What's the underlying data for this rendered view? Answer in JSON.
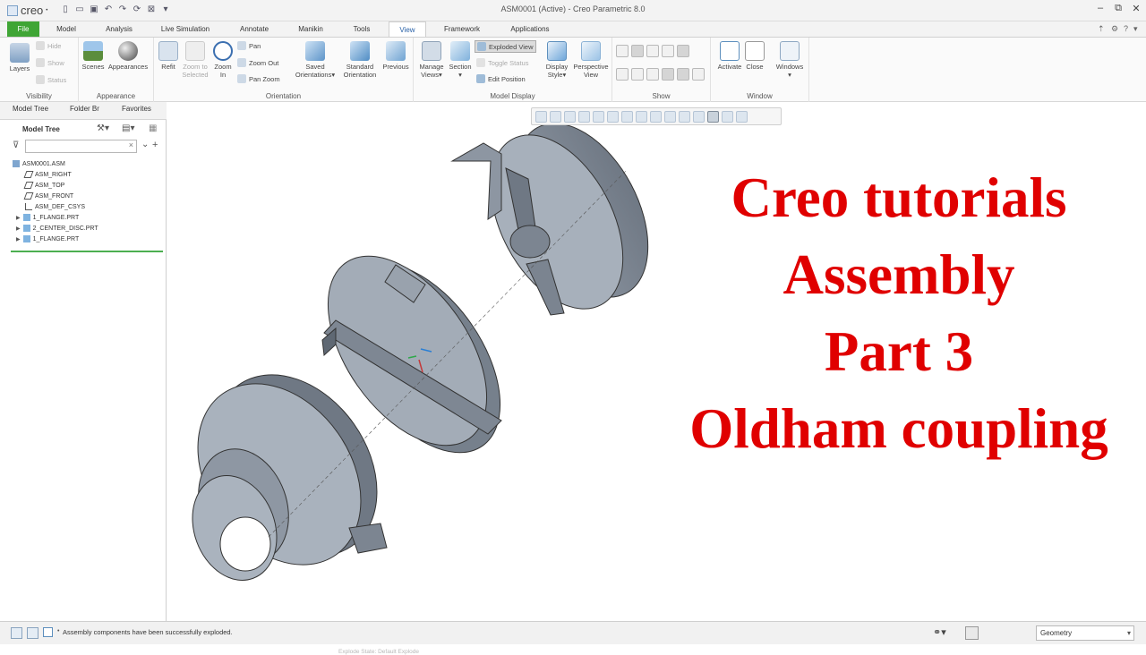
{
  "app": {
    "logo_text": "creo",
    "window_title": "ASM0001 (Active) - Creo Parametric 8.0"
  },
  "tabs": [
    {
      "label": "File"
    },
    {
      "label": "Model"
    },
    {
      "label": "Analysis"
    },
    {
      "label": "Live Simulation"
    },
    {
      "label": "Annotate"
    },
    {
      "label": "Manikin"
    },
    {
      "label": "Tools"
    },
    {
      "label": "View"
    },
    {
      "label": "Framework"
    },
    {
      "label": "Applications"
    }
  ],
  "ribbon": {
    "visibility": {
      "label": "Visibility",
      "layers": "Layers",
      "hide": "Hide",
      "show": "Show",
      "status": "Status"
    },
    "appearance": {
      "label": "Appearance",
      "scenes": "Scenes",
      "appearances": "Appearances"
    },
    "orientation": {
      "label": "Orientation",
      "refit": "Refit",
      "zoom_selected_1": "Zoom to",
      "zoom_selected_2": "Selected",
      "zoom_in_1": "Zoom",
      "zoom_in_2": "In",
      "pan": "Pan",
      "zoom_out": "Zoom Out",
      "pan_zoom": "Pan Zoom",
      "saved_1": "Saved",
      "saved_2": "Orientations",
      "standard_1": "Standard",
      "standard_2": "Orientation",
      "previous": "Previous"
    },
    "model_display": {
      "label": "Model Display",
      "manage_1": "Manage",
      "manage_2": "Views",
      "section": "Section",
      "exploded_view": "Exploded View",
      "toggle_status": "Toggle Status",
      "edit_position": "Edit Position",
      "display_1": "Display",
      "display_2": "Style",
      "perspective_1": "Perspective",
      "perspective_2": "View"
    },
    "show": {
      "label": "Show"
    },
    "window": {
      "label": "Window",
      "activate": "Activate",
      "close": "Close",
      "windows": "Windows"
    }
  },
  "left_panel": {
    "tabs": [
      {
        "label": "Model Tree"
      },
      {
        "label": "Folder Br"
      },
      {
        "label": "Favorites"
      }
    ],
    "tree_title": "Model Tree",
    "items": [
      {
        "label": "ASM0001.ASM",
        "icon": "assembly-icon"
      },
      {
        "label": "ASM_RIGHT",
        "icon": "datum-plane-icon"
      },
      {
        "label": "ASM_TOP",
        "icon": "datum-plane-icon"
      },
      {
        "label": "ASM_FRONT",
        "icon": "datum-plane-icon"
      },
      {
        "label": "ASM_DEF_CSYS",
        "icon": "csys-icon"
      },
      {
        "label": "1_FLANGE.PRT",
        "icon": "part-icon"
      },
      {
        "label": "2_CENTER_DISC.PRT",
        "icon": "part-icon"
      },
      {
        "label": "1_FLANGE.PRT",
        "icon": "part-icon"
      }
    ]
  },
  "graphics": {
    "overlay_lines": [
      "Creo tutorials",
      "Assembly",
      "Part 3",
      "Oldham coupling"
    ],
    "overlay_color": "#e00000",
    "explode_state": "Explode State: Default Explode"
  },
  "status": {
    "message": "Assembly components have been successfully exploded.",
    "selection_filter": "Geometry"
  }
}
